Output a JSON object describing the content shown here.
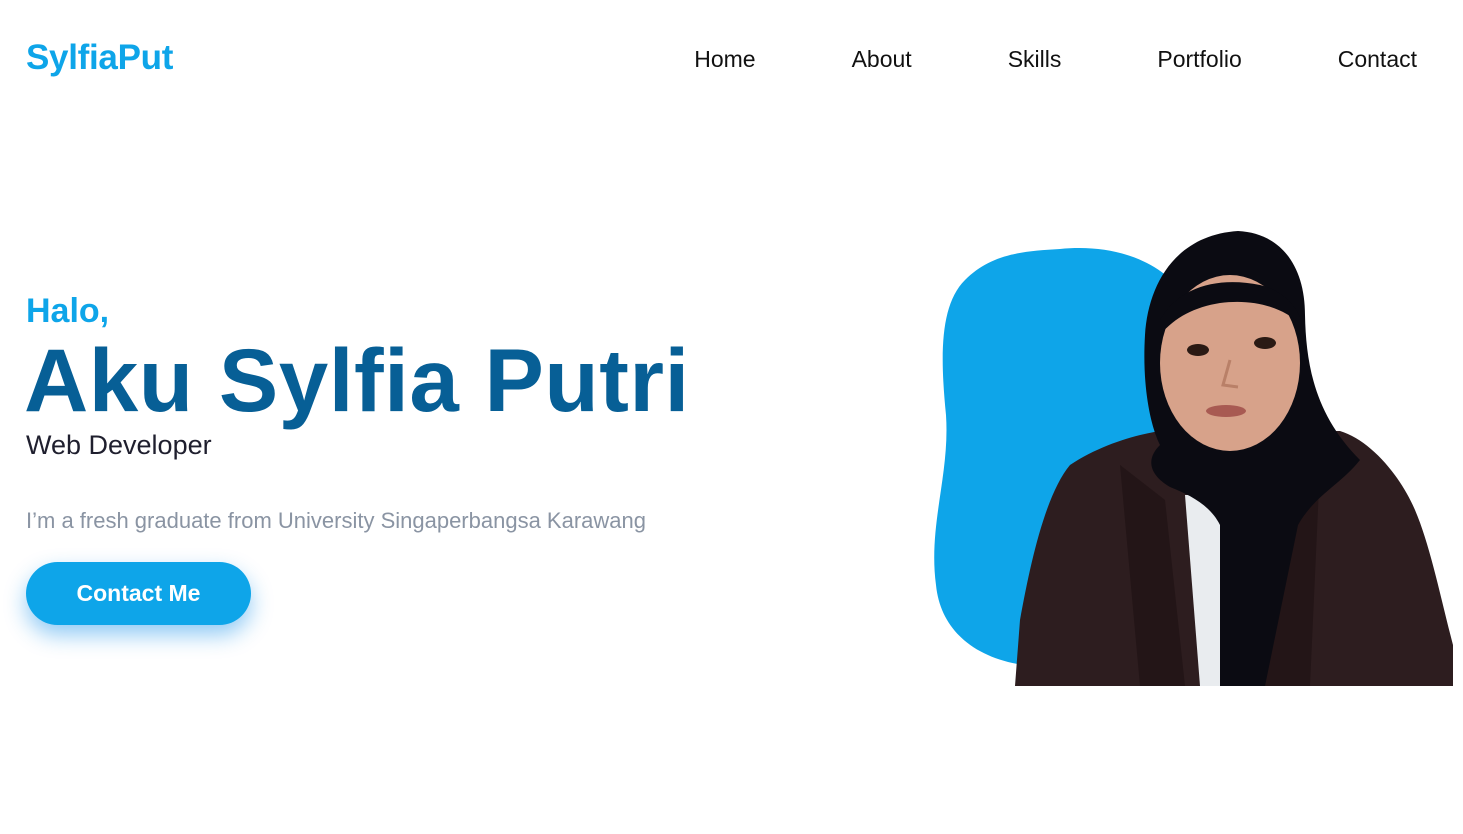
{
  "header": {
    "logo": "SylfiaPut",
    "nav": [
      {
        "label": "Home"
      },
      {
        "label": "About"
      },
      {
        "label": "Skills"
      },
      {
        "label": "Portfolio"
      },
      {
        "label": "Contact"
      }
    ]
  },
  "hero": {
    "greeting": "Halo,",
    "name": "Aku Sylfia Putri",
    "role": "Web Developer",
    "description": "I’m a fresh graduate from University Singaperbangsa Karawang",
    "cta_label": "Contact Me",
    "image": "portrait-photo"
  },
  "colors": {
    "accent": "#0ea5e9",
    "name_color": "#075f96",
    "muted_text": "#8a94a3"
  }
}
